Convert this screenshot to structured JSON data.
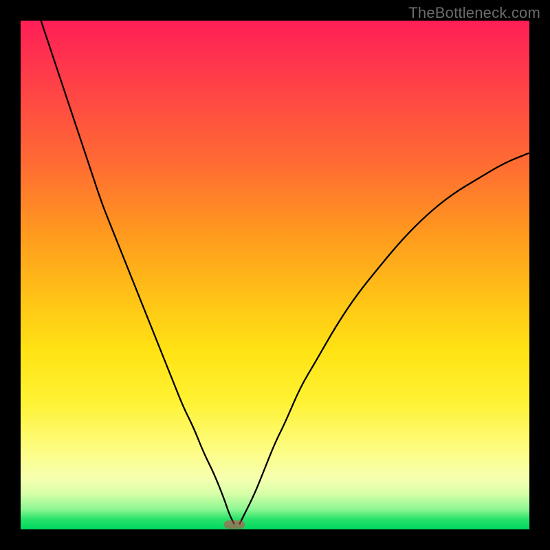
{
  "watermark": "TheBottleneck.com",
  "colors": {
    "frame": "#000000",
    "curve": "#000000",
    "marker": "rgba(220,60,80,0.55)"
  },
  "chart_data": {
    "type": "line",
    "title": "",
    "xlabel": "",
    "ylabel": "",
    "xlim": [
      0,
      100
    ],
    "ylim": [
      0,
      100
    ],
    "grid": false,
    "legend": false,
    "annotations": [
      {
        "label": "minimum-marker",
        "x": 42,
        "y": 1
      }
    ],
    "series": [
      {
        "name": "left-branch",
        "x": [
          4,
          6,
          8,
          10,
          12,
          14,
          16,
          18,
          20,
          22,
          24,
          26,
          28,
          30,
          32,
          34,
          36,
          38,
          40,
          41,
          42
        ],
        "values": [
          100,
          94,
          88,
          82,
          76,
          70,
          64,
          59,
          54,
          49,
          44,
          39,
          34,
          29,
          24,
          20,
          15,
          11,
          6,
          3,
          1
        ]
      },
      {
        "name": "right-branch",
        "x": [
          43,
          44,
          46,
          48,
          50,
          52,
          55,
          58,
          62,
          66,
          70,
          75,
          80,
          85,
          90,
          95,
          100
        ],
        "values": [
          1,
          3,
          7,
          12,
          17,
          21,
          28,
          33,
          40,
          46,
          51,
          57,
          62,
          66,
          69,
          72,
          74
        ]
      }
    ]
  }
}
